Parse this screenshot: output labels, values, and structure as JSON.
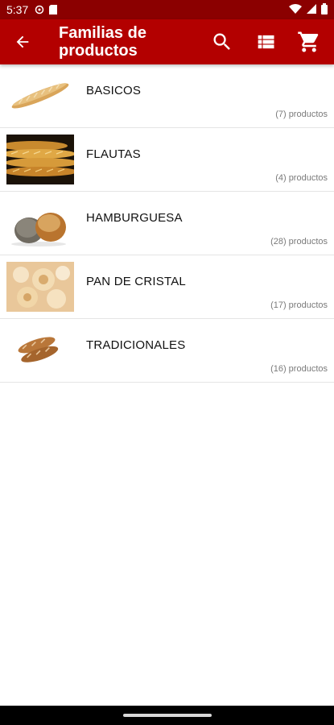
{
  "status_bar": {
    "time": "5:37",
    "icons": [
      "settings-gear-icon",
      "sim-card-icon",
      "wifi-icon",
      "signal-icon",
      "battery-icon"
    ]
  },
  "app_bar": {
    "title": "Familias de productos",
    "back_icon": "arrow-back-icon",
    "actions": [
      "search-icon",
      "list-view-icon",
      "shopping-cart-icon"
    ],
    "background_color": "#b30000"
  },
  "families": [
    {
      "name": "BASICOS",
      "count": "(7) productos",
      "image": "baguette"
    },
    {
      "name": "FLAUTAS",
      "count": "(4) productos",
      "image": "flutes"
    },
    {
      "name": "HAMBURGUESA",
      "count": "(28) productos",
      "image": "burger-buns"
    },
    {
      "name": "PAN DE CRISTAL",
      "count": "(17) productos",
      "image": "glass-bread"
    },
    {
      "name": "TRADICIONALES",
      "count": "(16) productos",
      "image": "rustic-loaves"
    }
  ]
}
